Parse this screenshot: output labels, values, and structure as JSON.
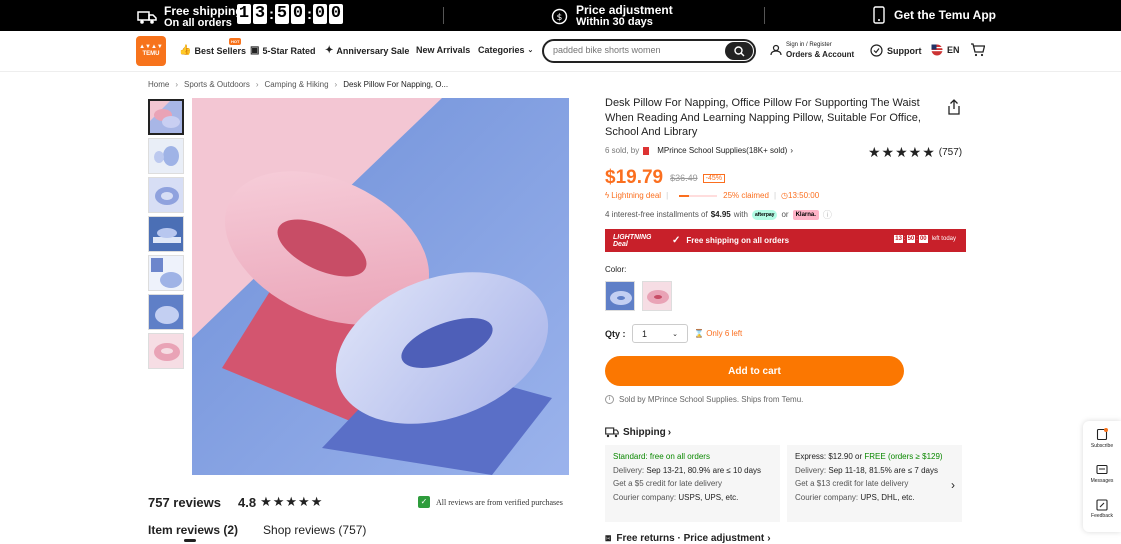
{
  "topbar": {
    "free_shipping": "Free shipping",
    "on_all_orders": "On all orders",
    "countdown": [
      "1",
      "3",
      "5",
      "0",
      "0",
      "0"
    ],
    "price_adjustment": "Price adjustment",
    "within_days": "Within 30 days",
    "get_app": "Get the Temu App"
  },
  "header": {
    "logo_text": "TEMU",
    "nav": {
      "best_sellers": "Best Sellers",
      "hot": "HOT",
      "five_star": "5-Star Rated",
      "anniversary": "Anniversary Sale",
      "new_arrivals": "New Arrivals",
      "categories": "Categories"
    },
    "search_placeholder": "padded bike shorts women",
    "account_small": "Sign in / Register",
    "account_big": "Orders & Account",
    "support": "Support",
    "language": "EN"
  },
  "breadcrumb": [
    "Home",
    "Sports & Outdoors",
    "Camping & Hiking",
    "Desk Pillow For Napping, O..."
  ],
  "reviews": {
    "count": "757 reviews",
    "rating": "4.8",
    "stars": "★★★★★",
    "verified": "All reviews are from verified purchases",
    "tab_item": "Item reviews (2)",
    "tab_shop": "Shop reviews (757)"
  },
  "product": {
    "title": "Desk Pillow For Napping, Office Pillow For Supporting The Waist When Reading And Learning Napping Pillow, Suitable For Office, School And Library",
    "sold": "6 sold, by",
    "seller": "MPrince School Supplies(18K+ sold)",
    "stars": "★★★★★",
    "rating_count": "(757)",
    "price": "$19.79",
    "old_price": "$36.49",
    "discount": "-45%",
    "lightning_deal": "Lightning deal",
    "claimed": "25% claimed",
    "claimed_fraction": 0.25,
    "deal_timer": "13:50:00",
    "installments_pre": "4 interest-free installments of",
    "installment_amount": "$4.95",
    "installments_with": "with",
    "afterpay": "afterpay",
    "or": "or",
    "klarna": "Klarna.",
    "banner_logo": "LIGHTNING Deal",
    "banner_free_shipping": "Free shipping on all orders",
    "banner_timer": [
      "13",
      "50",
      "00"
    ],
    "banner_left": "left today",
    "color_label": "Color:",
    "qty_label": "Qty :",
    "qty_value": "1",
    "only_left": "Only 6 left",
    "add_to_cart": "Add to cart",
    "sold_by": "Sold by MPrince School Supplies. Ships from Temu."
  },
  "shipping": {
    "heading": "Shipping",
    "standard": {
      "title": "Standard: free on all orders",
      "delivery_label": "Delivery:",
      "delivery": "Sep 13-21, 80.9% are ≤ 10 days",
      "credit": "Get a $5 credit for late delivery",
      "courier_label": "Courier company:",
      "courier": "USPS, UPS, etc."
    },
    "express": {
      "title_pre": "Express: $12.90 or",
      "title_free": "FREE (orders ≥ $129)",
      "delivery_label": "Delivery:",
      "delivery": "Sep 11-18, 81.5% are ≤ 7 days",
      "credit": "Get a $13 credit for late delivery",
      "courier_label": "Courier company:",
      "courier": "UPS, DHL, etc."
    },
    "free_returns": "Free returns · Price adjustment"
  },
  "floating": {
    "subscribe": "Subscribe",
    "messages": "Messages",
    "feedback": "Feedback"
  },
  "colors": {
    "brand_orange": "#fb7701",
    "lightning_red": "#c8202a",
    "price_orange": "#fb6f1f",
    "green": "#0a8800"
  }
}
